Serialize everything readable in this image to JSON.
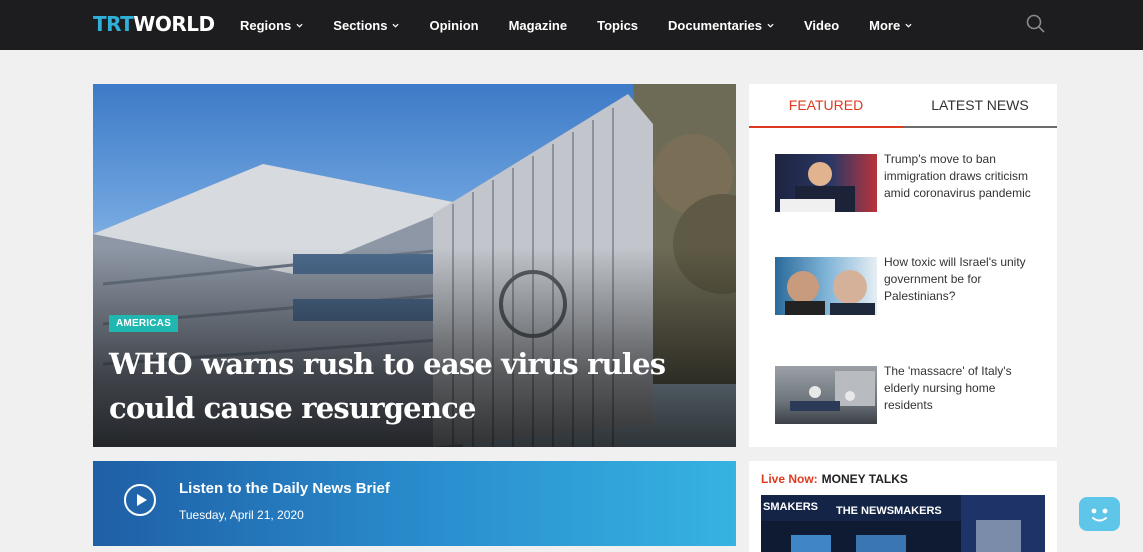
{
  "nav": {
    "logo_prefix": "TRT",
    "logo_suffix": "WORLD",
    "items": [
      {
        "label": "Regions",
        "dropdown": true
      },
      {
        "label": "Sections",
        "dropdown": true
      },
      {
        "label": "Opinion",
        "dropdown": false
      },
      {
        "label": "Magazine",
        "dropdown": false
      },
      {
        "label": "Topics",
        "dropdown": false
      },
      {
        "label": "Documentaries",
        "dropdown": true
      },
      {
        "label": "Video",
        "dropdown": false
      },
      {
        "label": "More",
        "dropdown": true
      }
    ],
    "search_icon": "search-icon"
  },
  "hero": {
    "tag": "AMERICAS",
    "title": "WHO warns rush to ease virus rules could cause resurgence"
  },
  "panel": {
    "tabs": [
      {
        "label": "FEATURED",
        "active": true
      },
      {
        "label": "LATEST NEWS",
        "active": false
      }
    ],
    "items": [
      {
        "title": "Trump's move to ban immigration draws criticism amid coronavirus pandemic"
      },
      {
        "title": "How toxic will Israel's unity government be for Palestinians?"
      },
      {
        "title": "The 'massacre' of Italy's elderly nursing home residents"
      }
    ]
  },
  "brief": {
    "title": "Listen to the Daily News Brief",
    "date": "Tuesday, April 21, 2020"
  },
  "live": {
    "label": "Live Now:",
    "show": "MONEY TALKS",
    "thumb_text_1": "SMAKERS",
    "thumb_text_2": "THE NEWSMAKERS"
  },
  "colors": {
    "accent": "#dd3a20",
    "logo_blue": "#2fb0d8",
    "tag": "#1fb7b0",
    "nav_bg": "#1d1d1f"
  }
}
